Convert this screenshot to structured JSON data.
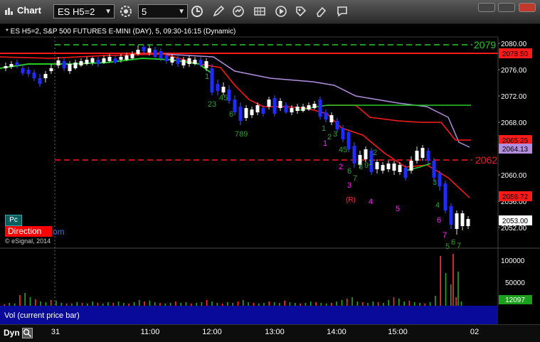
{
  "window": {
    "title": "Chart",
    "symbol": "ES H5=2",
    "interval": "5"
  },
  "toolbar": {
    "icons": [
      "settings-icon",
      "clock-icon",
      "pencil-icon",
      "refresh-icon",
      "grid-icon",
      "play-icon",
      "tag-icon",
      "eraser-icon",
      "note-icon"
    ]
  },
  "chart": {
    "header": "* ES H5=2, S&P 500 FUTURES E-MINI (DAY), 5, 09:30-16:15 (Dynamic)",
    "level_2079": "2079",
    "level_2062": "2062",
    "price_axis": [
      "2080.00",
      "2076.00",
      "2072.00",
      "2068.00",
      "2064.13",
      "2060.00",
      "2056.00",
      "2052.00"
    ],
    "price_tags": {
      "upper_red": "2078.50",
      "mid_red": "2065.25",
      "purple": "2064.13",
      "lower_red": "2056.72",
      "last": "2053.00"
    },
    "annotations_green": [
      "1",
      "23",
      "45",
      "6",
      "789",
      "1",
      "2",
      "3",
      "4",
      "5",
      "6",
      "7",
      "8",
      "9",
      "1",
      "2",
      "3",
      "4",
      "5",
      "6",
      "7"
    ],
    "annotations_magenta": [
      "1",
      "2",
      "3",
      "4",
      "5",
      "6",
      "7"
    ],
    "annotation_r": "(R)",
    "pc_label": "Pc",
    "direction_label": "Direction",
    "direction_suffix": "om",
    "copyright": "© eSignal, 2014"
  },
  "volume": {
    "label": "Vol (current price bar)",
    "axis": [
      "100000",
      "50000"
    ],
    "current": "12097"
  },
  "xaxis": {
    "dyn_label": "Dyn",
    "ticks": [
      "31",
      "11:00",
      "12:00",
      "13:00",
      "14:00",
      "15:00",
      "02"
    ]
  },
  "colors": {
    "up_candle": "#ffffff",
    "down_candle": "#1f2bff",
    "green_dashed": "#22cc22",
    "red_line": "#ff1a1a",
    "purple_line": "#b38ee0",
    "green_ma": "#22cc22",
    "magenta": "#ff22ff"
  }
}
